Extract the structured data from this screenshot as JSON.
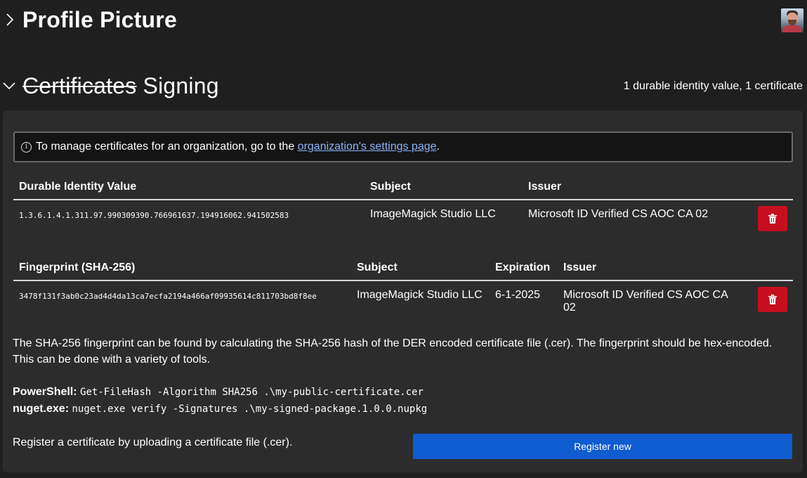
{
  "profile": {
    "title": "Profile Picture"
  },
  "certificates": {
    "title_struck": "Certificates",
    "title_rest": "Signing",
    "summary": "1 durable identity value, 1 certificate",
    "info": {
      "text_before": "To manage certificates for an organization, go to the",
      "link": "organization's settings page",
      "text_after": "."
    },
    "identity_table": {
      "headers": [
        "Durable Identity Value",
        "Subject",
        "Issuer"
      ],
      "rows": [
        {
          "value": "1.3.6.1.4.1.311.97.990309390.766961637.194916062.941502583",
          "subject": "ImageMagick Studio LLC",
          "issuer": "Microsoft ID Verified CS AOC CA 02"
        }
      ]
    },
    "fingerprint_table": {
      "headers": [
        "Fingerprint (SHA-256)",
        "Subject",
        "Expiration",
        "Issuer"
      ],
      "rows": [
        {
          "fingerprint": "3478f131f3ab0c23ad4d4da13ca7ecfa2194a466af09935614c811703bd8f8ee",
          "subject": "ImageMagick Studio LLC",
          "expiration": "6-1-2025",
          "issuer": "Microsoft ID Verified CS AOC CA 02"
        }
      ]
    },
    "description": "The SHA-256 fingerprint can be found by calculating the SHA-256 hash of the DER encoded certificate file (.cer). The fingerprint should be hex-encoded. This can be done with a variety of tools.",
    "commands": {
      "powershell_label": "PowerShell:",
      "powershell_cmd": "Get-FileHash -Algorithm SHA256 .\\my-public-certificate.cer",
      "nuget_label": "nuget.exe:",
      "nuget_cmd": "nuget.exe verify -Signatures .\\my-signed-package.1.0.0.nupkg"
    },
    "register_text": "Register a certificate by uploading a certificate file (.cer).",
    "register_button": "Register new"
  },
  "icons": {
    "collapsed": "chevron-right-icon",
    "expanded": "chevron-down-icon",
    "info": "info-icon",
    "delete": "trash-icon"
  },
  "colors": {
    "background": "#1f1f1f",
    "panel": "#2c2c2c",
    "delete": "#c50f1f",
    "primary": "#0f5bd0",
    "link": "#8ab4f8"
  }
}
